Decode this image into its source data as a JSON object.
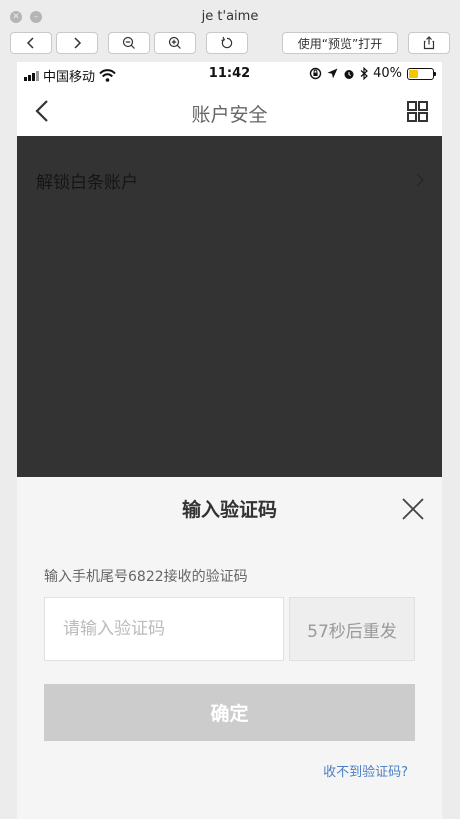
{
  "window": {
    "title": "je t'aime",
    "open_with_preview_label": "使用“预览”打开"
  },
  "icons": {
    "close": "close-icon",
    "minimize": "minimize-icon",
    "back": "chevron-left-icon",
    "forward": "chevron-right-icon",
    "zoom_out": "zoom-out-icon",
    "zoom_in": "zoom-in-icon",
    "rotate": "rotate-icon",
    "share": "share-icon",
    "wifi": "wifi-icon",
    "grid": "grid-icon"
  },
  "statusbar": {
    "carrier": "中国移动",
    "time": "11:42",
    "battery_percent_label": "40%",
    "battery_level": 0.4
  },
  "navbar": {
    "title": "账户安全"
  },
  "background_list": {
    "item_label": "解锁白条账户"
  },
  "sheet": {
    "title": "输入验证码",
    "hint": "输入手机尾号6822接收的验证码",
    "code_value": "",
    "code_placeholder": "请输入验证码",
    "resend_label": "57秒后重发",
    "confirm_label": "确定",
    "no_code_link": "收不到验证码?"
  },
  "colors": {
    "disabled_button": "#cccccc",
    "link": "#4a7fc1",
    "overlay": "#333333",
    "battery": "#f5c500"
  }
}
